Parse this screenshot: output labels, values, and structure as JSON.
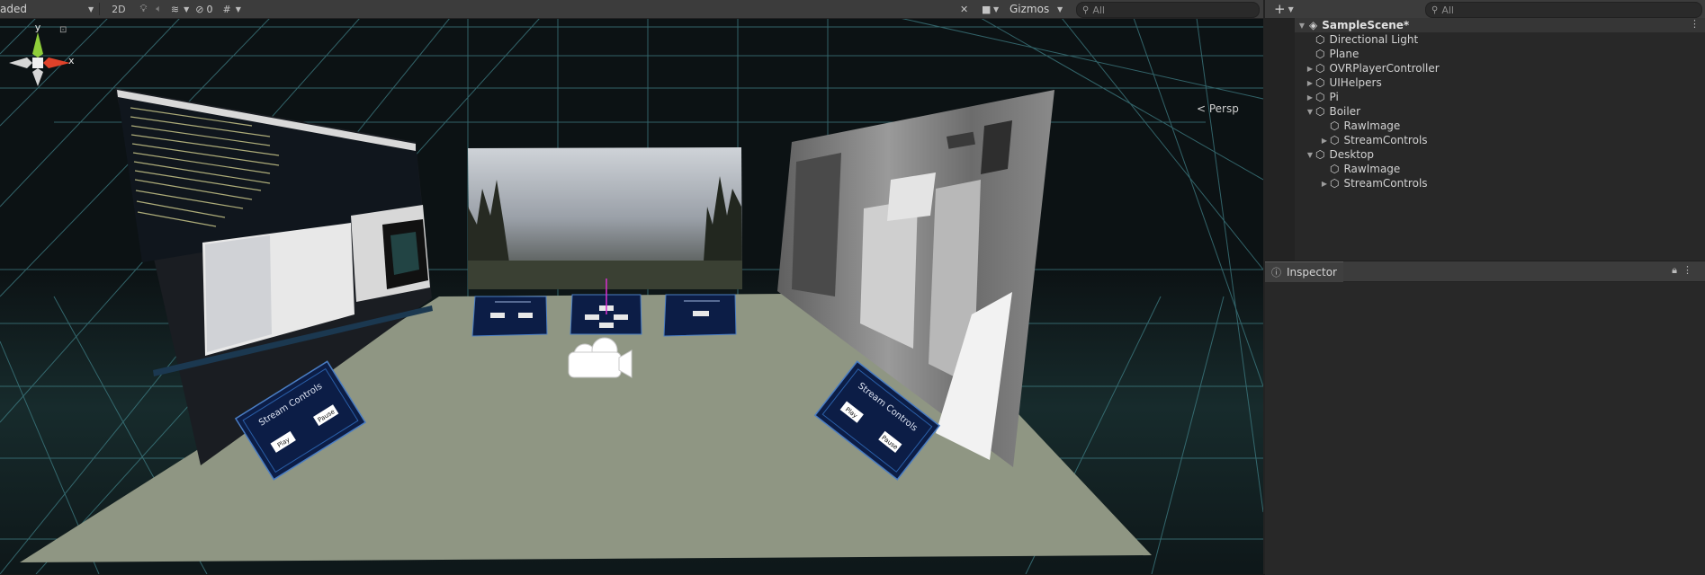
{
  "scene_toolbar": {
    "shading_mode": "aded",
    "mode_2d": "2D",
    "hidden_count": "0",
    "gizmos_label": "Gizmos",
    "search_placeholder": "All"
  },
  "scene_gizmo": {
    "axis_y": "y",
    "axis_x": "x",
    "projection_label": "< Persp"
  },
  "scene_panels": {
    "left_controls_title": "Stream Controls",
    "left_play": "Play",
    "left_pause": "Pause",
    "right_controls_title": "Stream Controls",
    "right_play": "Play",
    "right_pause": "Pause"
  },
  "hierarchy": {
    "search_placeholder": "All",
    "scene_name": "SampleScene*",
    "items": [
      {
        "label": "Directional Light"
      },
      {
        "label": "Plane"
      },
      {
        "label": "OVRPlayerController"
      },
      {
        "label": "UIHelpers"
      },
      {
        "label": "Pi"
      },
      {
        "label": "Boiler"
      },
      {
        "label": "RawImage"
      },
      {
        "label": "StreamControls"
      },
      {
        "label": "Desktop"
      },
      {
        "label": "RawImage"
      },
      {
        "label": "StreamControls"
      }
    ]
  },
  "inspector": {
    "tab_label": "Inspector"
  },
  "colors": {
    "editor_bg": "#282828",
    "toolbar_bg": "#3c3c3c",
    "scene_bg": "#0e1416",
    "grid_line": "#3f7f86",
    "floor": "#8f9683",
    "panel_blue": "#0c1d46",
    "axis_x_red": "#e0422a",
    "axis_y_green": "#8fce3a"
  }
}
